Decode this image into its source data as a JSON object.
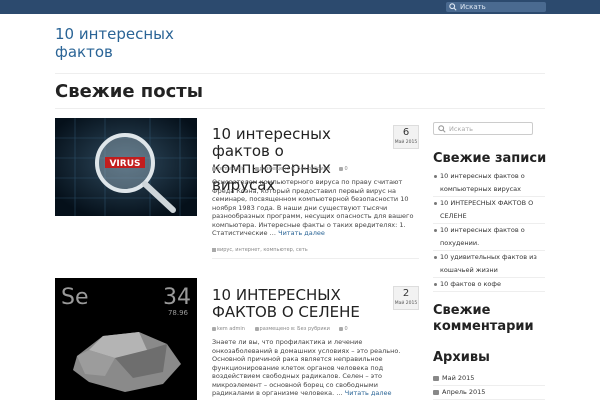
{
  "header": {
    "search_placeholder": "Искать",
    "site_title": "10 интересных фактов"
  },
  "page": {
    "title": "Свежие посты"
  },
  "posts": [
    {
      "title": "10 интересных фактов о компьютерных вирусах",
      "date_day": "6",
      "date_month": "Май 2015",
      "author": "kem admin",
      "category": "размещено в: Без рубрики",
      "comments": "0",
      "excerpt": "Основателем компьютерного вируса по праву считают Фреда Коэна, который предоставил первый вирус на семинаре, посвященном компьютерной безопасности 10 ноября 1983 года. В наши дни существуют тысячи разнообразных программ, несущих опасность для вашего компьютера. Интересные факты о таких вредителях: 1. Статистические …",
      "read_more": "Читать далее",
      "tags": "вирус, интернет, компьютер, сеть",
      "image_text": "VIRUS"
    },
    {
      "title": "10 ИНТЕРЕСНЫХ ФАКТОВ О СЕЛЕНЕ",
      "date_day": "2",
      "date_month": "Май 2015",
      "author": "kem admin",
      "category": "размещено в: Без рубрики",
      "comments": "0",
      "excerpt": "Знаете ли вы, что профилактика и лечение онкозаболеваний в домашних условиях – это реально. Основной причиной рака является неправильное функционирование клеток органов человека под воздействием свободных радикалов. Селен – это микроэлемент – основной борец со свободными радикалами в организме человека. …",
      "read_more": "Читать далее",
      "image_symbol": "Se",
      "image_number": "34",
      "image_mass": "78.96"
    }
  ],
  "sidebar": {
    "search_placeholder": "Искать",
    "recent_title": "Свежие записи",
    "recent_items": [
      "10 интересных фактов о компьютерных вирусах",
      "10 ИНТЕРЕСНЫХ ФАКТОВ О СЕЛЕНЕ",
      "10 интересных фактов о похудении.",
      "10 удивительных фактов из кошачьей жизни",
      "10 фактов о кофе"
    ],
    "comments_title": "Свежие комментарии",
    "archive_title": "Архивы",
    "archive_items": [
      "Май 2015",
      "Апрель 2015"
    ]
  },
  "colors": {
    "topbar": "#2c4a6e",
    "link": "#2a6496"
  }
}
